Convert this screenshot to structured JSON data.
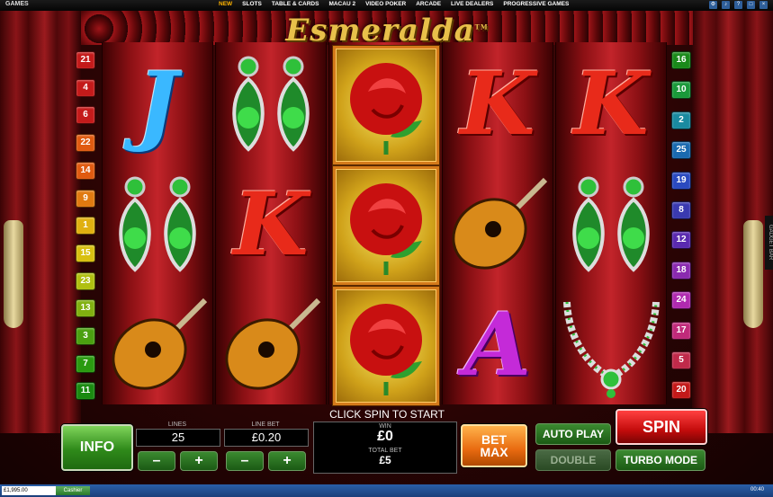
{
  "topbar": {
    "games_label": "GAMES",
    "nav": [
      "NEW",
      "SLOTS",
      "TABLE & CARDS",
      "MACAU 2",
      "VIDEO POKER",
      "ARCADE",
      "LIVE DEALERS",
      "PROGRESSIVE GAMES"
    ]
  },
  "game": {
    "title": "Esmeralda",
    "tm": "TM"
  },
  "paylines_left": [
    "21",
    "4",
    "6",
    "22",
    "14",
    "9",
    "1",
    "15",
    "23",
    "13",
    "3",
    "7",
    "11"
  ],
  "paylines_right": [
    "16",
    "10",
    "2",
    "25",
    "19",
    "8",
    "12",
    "18",
    "24",
    "17",
    "5",
    "20"
  ],
  "reels": [
    [
      "J",
      "earrings",
      "guitar"
    ],
    [
      "earrings",
      "K",
      "guitar"
    ],
    [
      "rose",
      "rose",
      "rose"
    ],
    [
      "K",
      "guitar",
      "A"
    ],
    [
      "K",
      "earrings",
      "necklace"
    ]
  ],
  "controls": {
    "prompt": "CLICK SPIN TO START",
    "info_label": "INFO",
    "lines_label": "LINES",
    "lines_value": "25",
    "linebet_label": "LINE BET",
    "linebet_value": "£0.20",
    "minus": "–",
    "plus": "+",
    "win_label": "WIN",
    "win_value": "£0",
    "totalbet_label": "TOTAL BET",
    "totalbet_value": "£5",
    "betmax_label": "BET MAX",
    "autoplay_label": "AUTO PLAY",
    "double_label": "DOUBLE",
    "spin_label": "SPIN",
    "turbo_label": "TURBO MODE"
  },
  "status": {
    "balance": "£1,995.00",
    "cashier_label": "Cashier",
    "clock": "00:40"
  },
  "gadget_label": "GADGET BAR",
  "colors": {
    "accent_gold": "#e8c04a",
    "reel_red": "#c2242a",
    "jack_blue": "#3ab8ff",
    "king_red": "#e82a1a",
    "ace_purple": "#c42ad8",
    "emerald": "#2fc03a"
  }
}
